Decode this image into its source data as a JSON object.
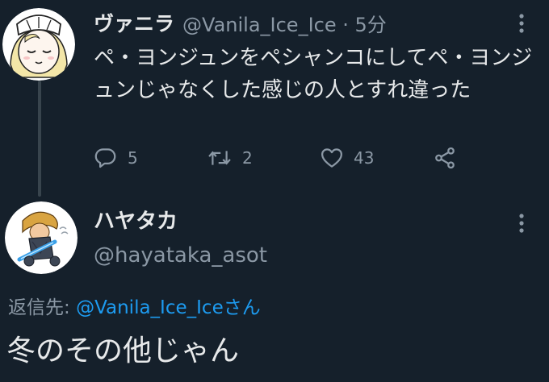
{
  "tweet1": {
    "display_name": "ヴァニラ",
    "handle_time": "@Vanila_Ice_Ice · 5分",
    "text": "ペ・ヨンジュンをペシャンコにしてペ・ヨンジュンじゃなくした感じの人とすれ違った",
    "actions": {
      "reply_count": "5",
      "retweet_count": "2",
      "like_count": "43"
    }
  },
  "tweet2": {
    "display_name": "ハヤタカ",
    "handle": "@hayataka_asot",
    "reply_prefix": "返信先: ",
    "reply_mention": "@Vanila_Ice_Iceさん",
    "text": "冬のその他じゃん"
  },
  "colors": {
    "background": "#15202b",
    "primary_text": "#e7e9ea",
    "secondary_text": "#8b98a5",
    "accent": "#1d9bf0",
    "thread_line": "#38444d"
  },
  "icons": [
    "reply-icon",
    "retweet-icon",
    "like-icon",
    "share-icon",
    "more-icon"
  ]
}
